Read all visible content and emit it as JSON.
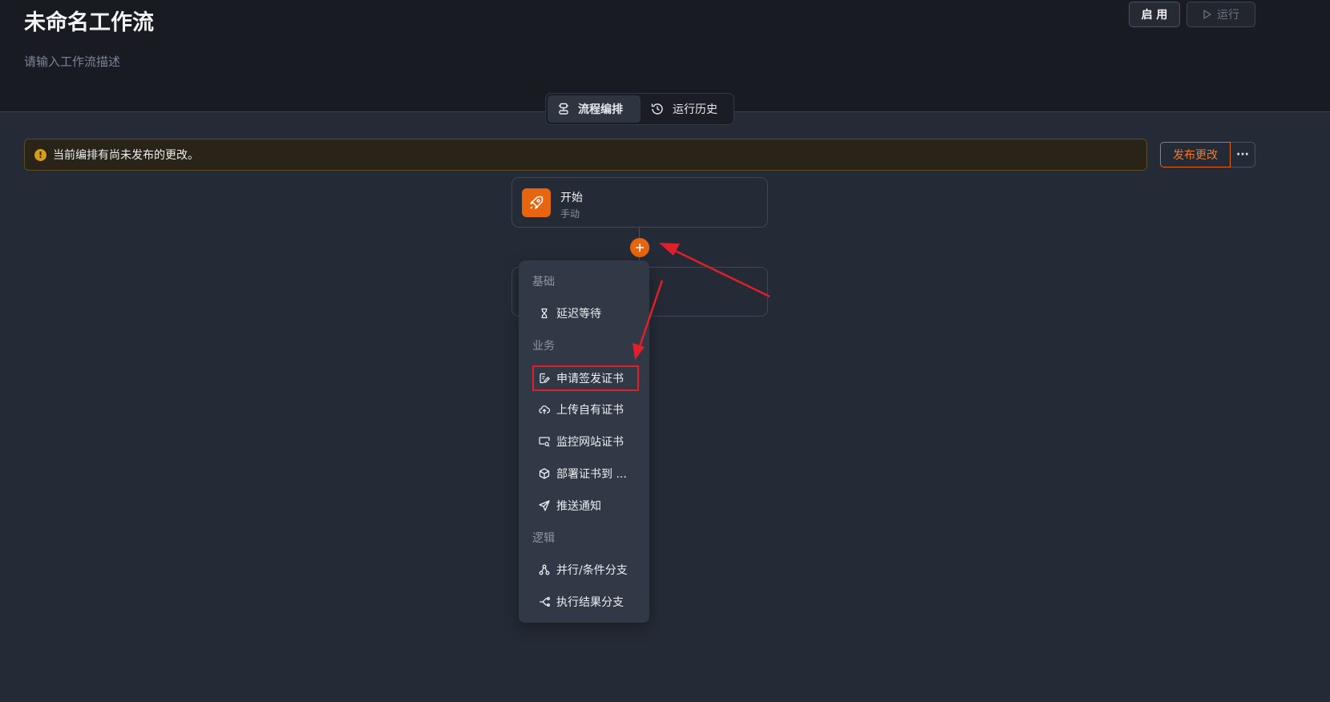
{
  "header": {
    "title": "未命名工作流",
    "description": "请输入工作流描述",
    "enable_label": "启 用",
    "run_label": "运行"
  },
  "tabs": [
    {
      "label": "流程编排",
      "active": true,
      "icon": "workflow-icon"
    },
    {
      "label": "运行历史",
      "active": false,
      "icon": "history-icon"
    }
  ],
  "alert": {
    "text": "当前编排有尚未发布的更改。",
    "publish_label": "发布更改",
    "more_label": "···"
  },
  "start_node": {
    "title": "开始",
    "subtitle": "手动",
    "icon": "rocket-icon"
  },
  "menu": {
    "groups": [
      {
        "label": "基础",
        "items": [
          {
            "label": "延迟等待",
            "icon": "hourglass-icon"
          }
        ]
      },
      {
        "label": "业务",
        "items": [
          {
            "label": "申请签发证书",
            "icon": "certificate-apply-icon",
            "highlighted": true
          },
          {
            "label": "上传自有证书",
            "icon": "cloud-upload-icon"
          },
          {
            "label": "监控网站证书",
            "icon": "monitor-search-icon"
          },
          {
            "label": "部署证书到 ...",
            "icon": "package-icon"
          },
          {
            "label": "推送通知",
            "icon": "send-icon"
          }
        ]
      },
      {
        "label": "逻辑",
        "items": [
          {
            "label": "并行/条件分支",
            "icon": "branch-icon"
          },
          {
            "label": "执行结果分支",
            "icon": "split-icon"
          }
        ]
      }
    ]
  },
  "colors": {
    "accent": "#e8650f",
    "annotation": "#e01f2a",
    "background": "#252b36"
  }
}
